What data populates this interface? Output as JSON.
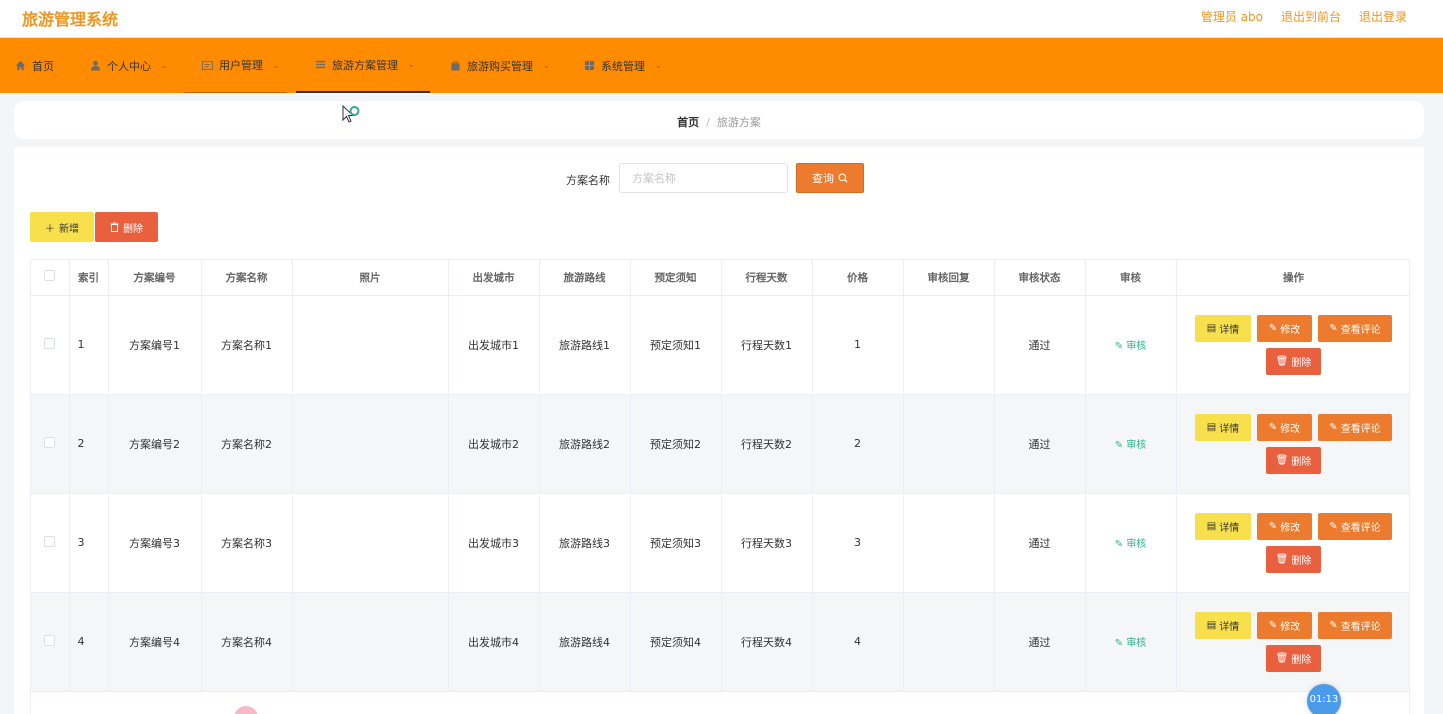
{
  "header": {
    "title": "旅游管理系统",
    "admin_label": "管理员 abo",
    "front_label": "退出到前台",
    "logout_label": "退出登录"
  },
  "nav": {
    "items": [
      {
        "label": "首页",
        "icon": "home-icon"
      },
      {
        "label": "个人中心",
        "icon": "user-icon"
      },
      {
        "label": "用户管理",
        "icon": "id-card-icon"
      },
      {
        "label": "旅游方案管理",
        "icon": "list-icon"
      },
      {
        "label": "旅游购买管理",
        "icon": "bag-icon"
      },
      {
        "label": "系统管理",
        "icon": "grid-icon"
      }
    ]
  },
  "breadcrumb": {
    "home": "首页",
    "separator": "/",
    "current": "旅游方案"
  },
  "search": {
    "label": "方案名称",
    "placeholder": "方案名称",
    "value": "",
    "button_label": "查询"
  },
  "actions": {
    "add_label": "新增",
    "delete_label": "删除"
  },
  "table": {
    "headers": [
      "索引",
      "方案编号",
      "方案名称",
      "照片",
      "出发城市",
      "旅游路线",
      "预定须知",
      "行程天数",
      "价格",
      "审核回复",
      "审核状态",
      "审核",
      "操作"
    ],
    "rows": [
      {
        "index": "1",
        "code": "方案编号1",
        "name": "方案名称1",
        "photo": "",
        "city": "出发城市1",
        "route": "旅游路线1",
        "notice": "预定须知1",
        "days": "行程天数1",
        "price": "1",
        "reply": "",
        "status": "通过"
      },
      {
        "index": "2",
        "code": "方案编号2",
        "name": "方案名称2",
        "photo": "",
        "city": "出发城市2",
        "route": "旅游路线2",
        "notice": "预定须知2",
        "days": "行程天数2",
        "price": "2",
        "reply": "",
        "status": "通过"
      },
      {
        "index": "3",
        "code": "方案编号3",
        "name": "方案名称3",
        "photo": "",
        "city": "出发城市3",
        "route": "旅游路线3",
        "notice": "预定须知3",
        "days": "行程天数3",
        "price": "3",
        "reply": "",
        "status": "通过"
      },
      {
        "index": "4",
        "code": "方案编号4",
        "name": "方案名称4",
        "photo": "",
        "city": "出发城市4",
        "route": "旅游路线4",
        "notice": "预定须知4",
        "days": "行程天数4",
        "price": "4",
        "reply": "",
        "status": "通过"
      }
    ],
    "audit_label": "审核",
    "op_detail": "详情",
    "op_edit": "修改",
    "op_review": "查看评论",
    "op_delete": "删除"
  },
  "overlay": {
    "timer": "01:13"
  },
  "colors": {
    "brand": "#f0961e",
    "nav_bg": "#ff8c00",
    "btn_orange": "#ec7b2e",
    "btn_yellow": "#f7e04b",
    "btn_red": "#e9603f",
    "audit_green": "#2bb88a"
  }
}
